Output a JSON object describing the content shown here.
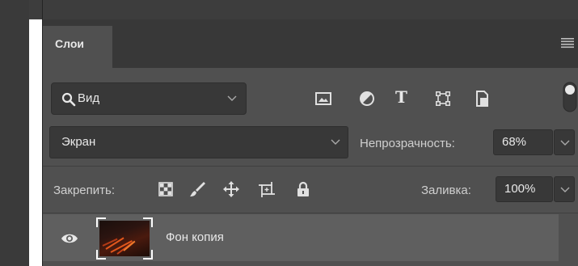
{
  "panel": {
    "tab_label": "Слои"
  },
  "filter": {
    "search_value": "Вид",
    "icons": [
      "image-icon",
      "adjustment-icon",
      "type-icon",
      "shape-icon",
      "smart-object-icon"
    ],
    "type_glyph": "T"
  },
  "blend": {
    "mode": "Экран",
    "opacity_label": "Непрозрачность:",
    "opacity_value": "68%"
  },
  "lock": {
    "label": "Закрепить:",
    "icons": [
      "transparency-lock-icon",
      "brush-lock-icon",
      "move-lock-icon",
      "artboard-lock-icon",
      "lock-icon"
    ],
    "fill_label": "Заливка:",
    "fill_value": "100%"
  },
  "layers": [
    {
      "name": "Фон копия",
      "visible": true
    }
  ],
  "colors": {
    "panel_bg": "#505050",
    "tab_bar_bg": "#383838",
    "field_bg": "#383838",
    "selected_row_bg": "#5f5f5f",
    "text": "#e8e8e8"
  }
}
